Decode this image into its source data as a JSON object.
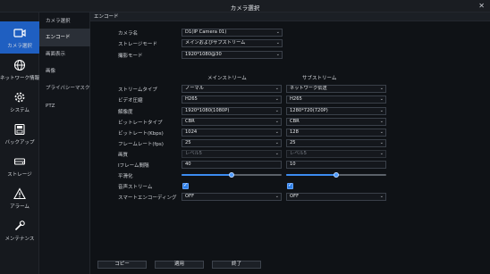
{
  "window": {
    "title": "カメラ選択",
    "close_glyph": "✕"
  },
  "sidebar": {
    "items": [
      {
        "label": "カメラ選択",
        "icon": "camera-icon"
      },
      {
        "label": "ネットワーク情報",
        "icon": "globe-icon"
      },
      {
        "label": "システム",
        "icon": "gear-icon"
      },
      {
        "label": "バックアップ",
        "icon": "backup-icon"
      },
      {
        "label": "ストレージ",
        "icon": "storage-icon"
      },
      {
        "label": "アラーム",
        "icon": "alarm-icon"
      },
      {
        "label": "メンテナンス",
        "icon": "wrench-icon"
      }
    ],
    "active_color": "#1f5fc1"
  },
  "submenu": {
    "items": [
      "カメラ選択",
      "エンコード",
      "画面表示",
      "画像",
      "プライバシーマスク",
      "PTZ"
    ],
    "active_index": 1
  },
  "section": {
    "title": "エンコード"
  },
  "camera": {
    "name_label": "カメラ名",
    "name_value": "D1(IP Camera 01)",
    "storage_mode_label": "ストレージモード",
    "storage_mode_value": "メインおよびサブストリーム",
    "record_mode_label": "撮影モード",
    "record_mode_value": "1920*1080@30"
  },
  "columns": {
    "main": "メインストリーム",
    "sub": "サブストリーム"
  },
  "rows": [
    {
      "label": "ストリームタイプ",
      "main": "ノーマル",
      "sub": "ネットワーク伝送"
    },
    {
      "label": "ビデオ圧縮",
      "main": "H265",
      "sub": "H265"
    },
    {
      "label": "解像度",
      "main": "1920*1080(1080P)",
      "sub": "1280*720(720P)"
    },
    {
      "label": "ビットレートタイプ",
      "main": "CBR",
      "sub": "CBR"
    },
    {
      "label": "ビットレート(Kbps)",
      "main": "1024",
      "sub": "128"
    },
    {
      "label": "フレームレート(fps)",
      "main": "25",
      "sub": "25"
    },
    {
      "label": "画質",
      "main": "レベル5",
      "sub": "レベル5"
    },
    {
      "label": "Iフレーム間隔",
      "main": "40",
      "sub": "10"
    },
    {
      "label": "平滑化",
      "main_level": 0.5,
      "sub_level": 0.5
    },
    {
      "label": "音声ストリーム",
      "main_checked": true,
      "sub_checked": true
    },
    {
      "label": "スマートエンコーディング",
      "main": "OFF",
      "sub": "OFF"
    }
  ],
  "buttons": {
    "copy": "コピー",
    "apply": "適用",
    "exit": "終了"
  },
  "arrow_glyph": "⌄",
  "check_glyph": "✓"
}
